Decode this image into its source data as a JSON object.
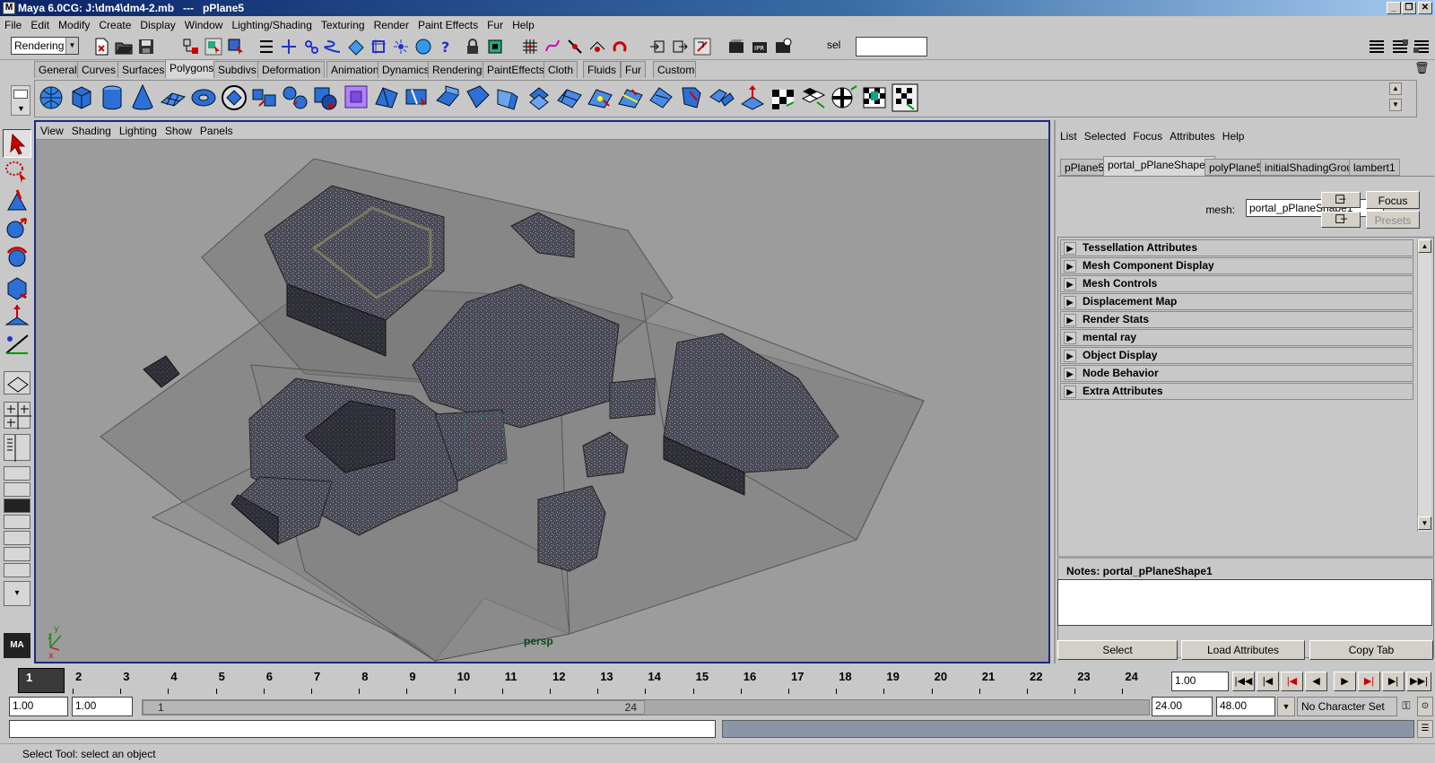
{
  "window": {
    "title": "Maya 6.0CG: J:\\dm4\\dm4-2.mb   ---   pPlane5",
    "icon": "maya-app-icon",
    "controls": [
      "minimize",
      "restore",
      "close"
    ]
  },
  "menubar": [
    "File",
    "Edit",
    "Modify",
    "Create",
    "Display",
    "Window",
    "Lighting/Shading",
    "Texturing",
    "Render",
    "Paint Effects",
    "Fur",
    "Help"
  ],
  "statusline": {
    "menu_set": "Rendering",
    "sel_label": "sel",
    "sel_value": ""
  },
  "shelf_tabs": [
    "General",
    "Curves",
    "Surfaces",
    "Polygons",
    "Subdivs",
    "Deformation",
    "Animation",
    "Dynamics",
    "Rendering",
    "PaintEffects",
    "Cloth",
    "Fluids",
    "Fur",
    "Custom"
  ],
  "active_shelf_tab": "Polygons",
  "viewport": {
    "menu": [
      "View",
      "Shading",
      "Lighting",
      "Show",
      "Panels"
    ],
    "camera": "persp",
    "axis": {
      "x": "x",
      "y": "y",
      "z": "z"
    }
  },
  "attribute_editor": {
    "menu": [
      "List",
      "Selected",
      "Focus",
      "Attributes",
      "Help"
    ],
    "tabs": [
      "pPlane5",
      "portal_pPlaneShape1",
      "polyPlane5",
      "initialShadingGroup",
      "lambert1"
    ],
    "active_tab": "portal_pPlaneShape1",
    "mesh_label": "mesh:",
    "mesh_value": "portal_pPlaneShape1",
    "focus_label": "Focus",
    "presets_label": "Presets",
    "sections": [
      "Tessellation Attributes",
      "Mesh Component Display",
      "Mesh Controls",
      "Displacement Map",
      "Render Stats",
      "mental ray",
      "Object Display",
      "Node Behavior",
      "Extra Attributes"
    ],
    "notes_title": "Notes:  portal_pPlaneShape1",
    "notes_value": "",
    "buttons": {
      "select": "Select",
      "load": "Load Attributes",
      "copy": "Copy Tab"
    }
  },
  "timeline": {
    "current_frame": "1",
    "ticks": [
      "2",
      "3",
      "4",
      "5",
      "6",
      "7",
      "8",
      "9",
      "10",
      "11",
      "12",
      "13",
      "14",
      "15",
      "16",
      "17",
      "18",
      "19",
      "20",
      "21",
      "22",
      "23",
      "24"
    ],
    "current_time_field": "1.00"
  },
  "range": {
    "start_time": "1.00",
    "playback_start": "1.00",
    "range_start_label": "1",
    "range_end_label": "24",
    "playback_end": "24.00",
    "end_time": "48.00",
    "character_set": "No Character Set"
  },
  "helpline": "Select Tool: select an object",
  "colors": {
    "title_start": "#0a246a",
    "viewport_bg": "#9c9c9c",
    "viewport_border": "#1a2a80",
    "camera_label": "#0a4a1a"
  }
}
